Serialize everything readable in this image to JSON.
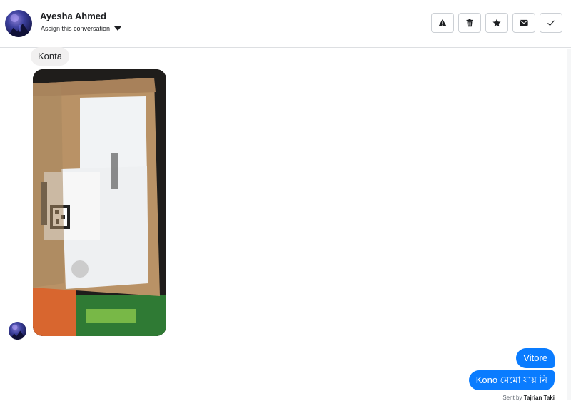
{
  "header": {
    "name": "Ayesha Ahmed",
    "assign_label": "Assign this conversation",
    "actions": [
      {
        "name": "report",
        "icon": "warning-icon"
      },
      {
        "name": "delete",
        "icon": "trash-icon"
      },
      {
        "name": "star",
        "icon": "star-icon"
      },
      {
        "name": "mark-unread",
        "icon": "envelope-icon"
      },
      {
        "name": "done",
        "icon": "check-icon"
      }
    ]
  },
  "messages": {
    "incoming_text": "Konta",
    "incoming_photo": "package-photo",
    "outgoing": [
      "Vitore",
      "Kono মেমো যায় নি"
    ]
  },
  "sent_by": {
    "prefix": "Sent by",
    "name": "Tajrian Taki"
  },
  "colors": {
    "outgoing_bubble": "#0a7cff",
    "incoming_bubble": "#f1f0f0"
  }
}
